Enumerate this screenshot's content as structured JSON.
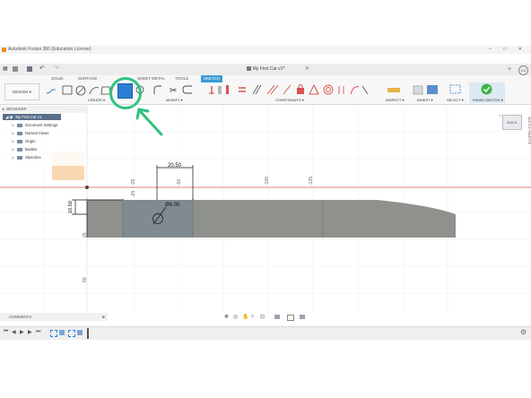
{
  "window": {
    "title": "Autodesk Fusion 360 (Education License)"
  },
  "document": {
    "title": "My First Car v1*"
  },
  "tabs": [
    {
      "label": "SOLID"
    },
    {
      "label": "SURFACE"
    },
    {
      "label": "SHEET METAL"
    },
    {
      "label": "TOOLS"
    },
    {
      "label": "SKETCH"
    }
  ],
  "ribbon": {
    "design_label": "DESIGN",
    "groups": {
      "create": "CREATE",
      "modify": "MODIFY",
      "constraints": "CONSTRAINTS",
      "inspect": "INSPECT",
      "insert": "INSERT",
      "select": "SELECT",
      "finish": "FINISH SKETCH"
    }
  },
  "browser": {
    "header": "BROWSER",
    "root": "My First Car v1",
    "items": [
      {
        "label": "Document Settings"
      },
      {
        "label": "Named Views"
      },
      {
        "label": "Origin"
      },
      {
        "label": "Bodies"
      },
      {
        "label": "Sketches"
      }
    ]
  },
  "comments": {
    "label": "COMMENTS"
  },
  "viewcube": {
    "label": "BACK"
  },
  "sketch_palette": {
    "label": "SKETCH PALETTE"
  },
  "canvas": {
    "dims": {
      "top_width": "20.50",
      "height": "10.50",
      "hole": "Ø6.00"
    },
    "ruler_labels": [
      "-25",
      "-50",
      "-100",
      "-125",
      "25",
      "50",
      "-25"
    ]
  },
  "colors": {
    "accent": "#3c9bd7",
    "finish_green": "#3cb54a",
    "highlight_circle": "#2ec27e",
    "selected_tool": "#2a7fd4",
    "axis_red": "#d9534f",
    "body_gray": "#8f918d"
  }
}
